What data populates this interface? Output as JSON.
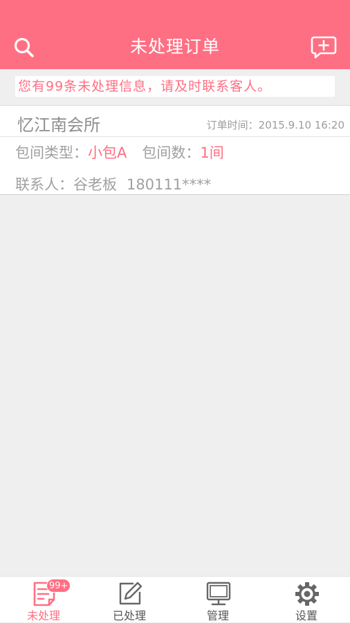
{
  "header": {
    "title": "未处理订单",
    "search_icon": "search-icon",
    "add_message_icon": "add-message-icon"
  },
  "notice": {
    "text": "您有99条未处理信息，请及时联系客人。"
  },
  "orders": [
    {
      "venue": "忆江南会所",
      "time_label": "订单时间：",
      "time_value": "2015.9.10 16:20",
      "room_type_label": "包间类型：",
      "room_type_value": "小包A",
      "room_count_label": "包间数：",
      "room_count_value": "1间",
      "contact_label": "联系人：",
      "contact_name": "谷老板",
      "contact_phone": "180111****"
    }
  ],
  "tabs": [
    {
      "label": "未处理",
      "icon": "pending-list-icon",
      "badge": "99+",
      "active": true
    },
    {
      "label": "已处理",
      "icon": "edit-icon",
      "active": false
    },
    {
      "label": "管理",
      "icon": "monitor-icon",
      "active": false
    },
    {
      "label": "设置",
      "icon": "gear-icon",
      "active": false
    }
  ],
  "colors": {
    "brand": "#ff6f83",
    "background": "#efefef",
    "text_muted": "#a0a0a0"
  }
}
